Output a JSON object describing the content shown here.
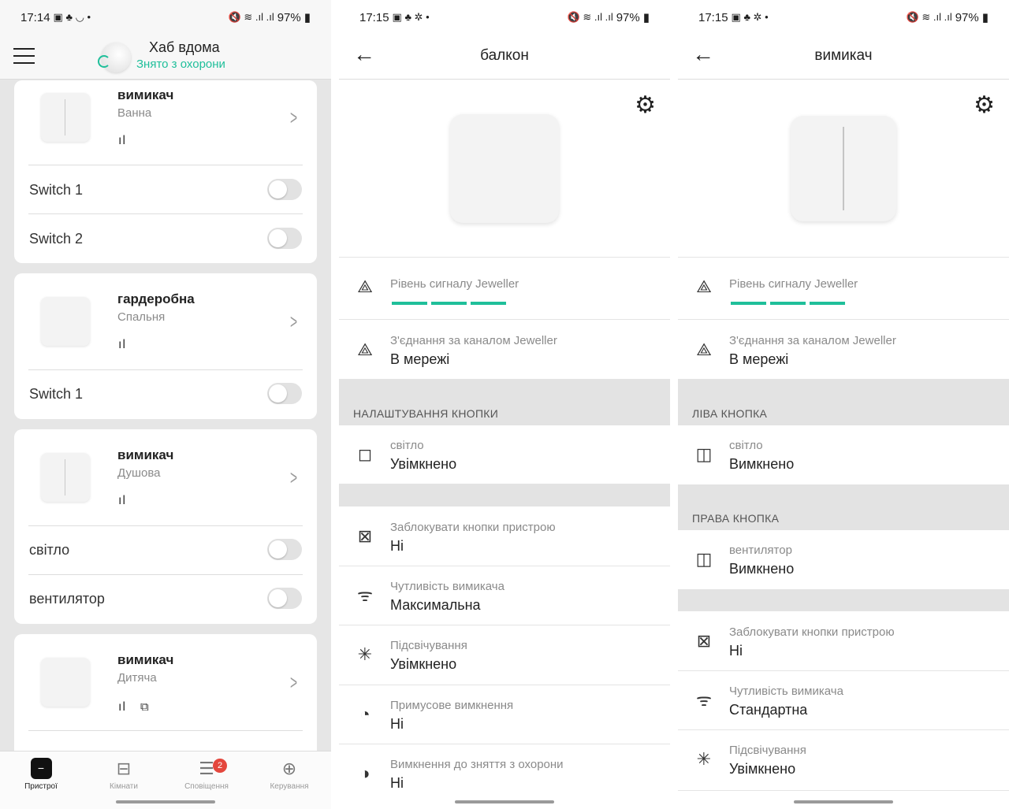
{
  "screen1": {
    "status": {
      "time": "17:14",
      "battery": "97%"
    },
    "hub": {
      "title": "Хаб вдома",
      "subtitle": "Знято з охорони"
    },
    "devices": [
      {
        "name": "вимикач",
        "room": "Ванна",
        "switches": [
          "Switch 1",
          "Switch 2"
        ]
      },
      {
        "name": "гардеробна",
        "room": "Спальня",
        "switches": [
          "Switch 1"
        ]
      },
      {
        "name": "вимикач",
        "room": "Душова",
        "switches": [
          "світло",
          "вентилятор"
        ]
      },
      {
        "name": "вимикач",
        "room": "Дитяча",
        "switches": []
      }
    ],
    "nav": [
      {
        "label": "Пристрої",
        "icon": "devices-icon"
      },
      {
        "label": "Кімнати",
        "icon": "rooms-icon"
      },
      {
        "label": "Сповіщення",
        "icon": "notifications-icon",
        "badge": "2"
      },
      {
        "label": "Керування",
        "icon": "control-icon"
      }
    ]
  },
  "screen2": {
    "status": {
      "time": "17:15",
      "battery": "97%"
    },
    "title": "балкон",
    "signal_label": "Рівень сигналу Jeweller",
    "connection": {
      "label": "З'єднання за каналом Jeweller",
      "value": "В мережі"
    },
    "section_button": "НАЛАШТУВАННЯ КНОПКИ",
    "button": {
      "label": "світло",
      "value": "Увімкнено"
    },
    "settings": [
      {
        "label": "Заблокувати кнопки пристрою",
        "value": "Ні",
        "icon": "lock-x-icon"
      },
      {
        "label": "Чутливість вимикача",
        "value": "Максимальна",
        "icon": "sensitivity-icon"
      },
      {
        "label": "Підсвічування",
        "value": "Увімкнено",
        "icon": "backlight-icon"
      },
      {
        "label": "Примусове вимкнення",
        "value": "Ні",
        "icon": "forced-off-icon"
      },
      {
        "label": "Вимкнення до зняття з охорони",
        "value": "Ні",
        "icon": "disarm-off-icon"
      }
    ]
  },
  "screen3": {
    "status": {
      "time": "17:15",
      "battery": "97%"
    },
    "title": "вимикач",
    "signal_label": "Рівень сигналу Jeweller",
    "connection": {
      "label": "З'єднання за каналом Jeweller",
      "value": "В мережі"
    },
    "section_left": "ЛІВА КНОПКА",
    "left": {
      "label": "світло",
      "value": "Вимкнено"
    },
    "section_right": "ПРАВА КНОПКА",
    "right": {
      "label": "вентилятор",
      "value": "Вимкнено"
    },
    "settings": [
      {
        "label": "Заблокувати кнопки пристрою",
        "value": "Ні",
        "icon": "lock-x-icon"
      },
      {
        "label": "Чутливість вимикача",
        "value": "Стандартна",
        "icon": "sensitivity-icon"
      },
      {
        "label": "Підсвічування",
        "value": "Увімкнено",
        "icon": "backlight-icon"
      }
    ]
  },
  "signal_level": {
    "bars_filled": 3,
    "bars_total": 3
  },
  "colors": {
    "accent": "#1fbf9a",
    "badge": "#e4473d",
    "section_bg": "#e3e3e3"
  }
}
